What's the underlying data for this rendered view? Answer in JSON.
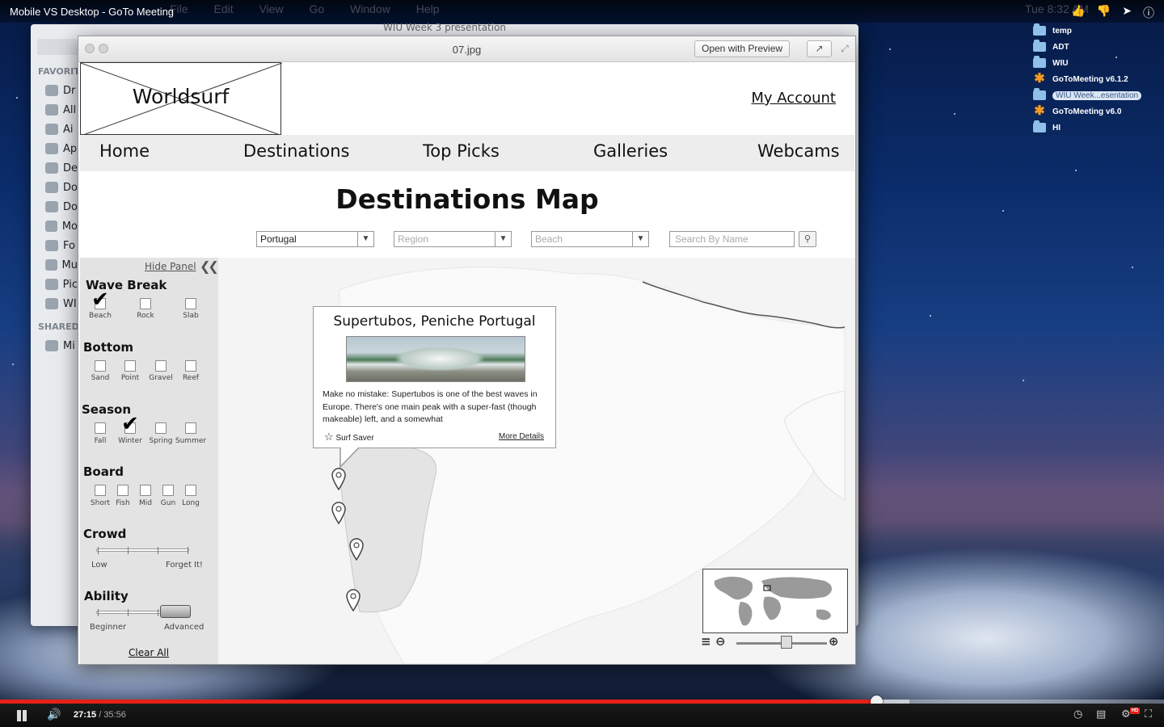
{
  "video": {
    "title": "Mobile VS Desktop - GoTo Meeting",
    "time_current": "27:15",
    "time_separator": " / ",
    "time_duration": "35:56",
    "progress_fraction": 0.753,
    "buffered_fraction": 0.781,
    "hd_label": "HD"
  },
  "menubar": {
    "items": [
      "File",
      "Edit",
      "View",
      "Go",
      "Window",
      "Help"
    ],
    "clock": "Tue 8:32 AM"
  },
  "desktop": {
    "items": [
      {
        "label": "temp",
        "icon": "folder-icon"
      },
      {
        "label": "ADT",
        "icon": "folder-icon"
      },
      {
        "label": "WIU",
        "icon": "folder-icon"
      },
      {
        "label": "GoToMeeting v6.1.2",
        "icon": "gotomeeting-icon"
      },
      {
        "label": "WIU Week...esentation",
        "icon": "folder-icon",
        "selected": true
      },
      {
        "label": "GoToMeeting v6.0",
        "icon": "gotomeeting-icon"
      },
      {
        "label": "HI",
        "icon": "folder-icon"
      }
    ]
  },
  "finder": {
    "title": "WIU Week 3 presentation",
    "favorites_label": "FAVORIT",
    "shared_label": "SHARED",
    "favorites": [
      "Dr",
      "All",
      "Ai",
      "Ap",
      "De",
      "Do",
      "Do",
      "Mo",
      "Fo",
      "Mu",
      "Pic",
      "WI"
    ],
    "shared": [
      "Mi"
    ]
  },
  "preview": {
    "filename": "07.jpg",
    "open_with_label": "Open with Preview"
  },
  "wireframe": {
    "logo": "Worldsurf",
    "my_account": "My Account",
    "nav": [
      "Home",
      "Destinations",
      "Top Picks",
      "Galleries",
      "Webcams"
    ],
    "page_title": "Destinations Map",
    "filters": {
      "country": "Portugal",
      "region_placeholder": "Region",
      "beach_placeholder": "Beach",
      "search_placeholder": "Search By Name"
    },
    "panel": {
      "hide_label": "Hide Panel",
      "clear_all": "Clear All",
      "groups": {
        "wave_break": {
          "title": "Wave Break",
          "options": [
            {
              "label": "Beach",
              "checked": true
            },
            {
              "label": "Rock",
              "checked": false
            },
            {
              "label": "Slab",
              "checked": false
            }
          ]
        },
        "bottom": {
          "title": "Bottom",
          "options": [
            {
              "label": "Sand",
              "checked": false
            },
            {
              "label": "Point",
              "checked": false
            },
            {
              "label": "Gravel",
              "checked": false
            },
            {
              "label": "Reef",
              "checked": false
            }
          ]
        },
        "season": {
          "title": "Season",
          "options": [
            {
              "label": "Fall",
              "checked": false
            },
            {
              "label": "Winter",
              "checked": true
            },
            {
              "label": "Spring",
              "checked": false
            },
            {
              "label": "Summer",
              "checked": false
            }
          ]
        },
        "board": {
          "title": "Board",
          "options": [
            {
              "label": "Short",
              "checked": false
            },
            {
              "label": "Fish",
              "checked": false
            },
            {
              "label": "Mid",
              "checked": false
            },
            {
              "label": "Gun",
              "checked": false
            },
            {
              "label": "Long",
              "checked": false
            }
          ]
        }
      },
      "crowd": {
        "title": "Crowd",
        "min_label": "Low",
        "max_label": "Forget It!"
      },
      "ability": {
        "title": "Ability",
        "min_label": "Beginner",
        "max_label": "Advanced",
        "level_fraction": 0.85
      }
    },
    "popup": {
      "title": "Supertubos, Peniche Portugal",
      "description": "Make no mistake: Supertubos is one of the best waves in Europe. There's one main peak with a super-fast (though makeable) left, and a somewhat",
      "save_label": "Surf Saver",
      "more_details": "More Details"
    },
    "zoom_level_fraction": 0.55
  }
}
